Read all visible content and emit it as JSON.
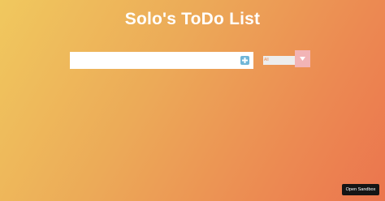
{
  "title": "Solo's ToDo List",
  "todo_input": {
    "value": "",
    "placeholder": ""
  },
  "add_button": {
    "icon": "plus-square-icon",
    "color": "#6fb6d8"
  },
  "filter": {
    "selected": "All",
    "arrow_icon": "caret-down-icon",
    "accent": "#f2b4b6"
  },
  "sandbox_button": {
    "label": "Open Sandbox"
  },
  "colors": {
    "gradient_start": "#f0c85e",
    "gradient_end": "#eb754e"
  }
}
